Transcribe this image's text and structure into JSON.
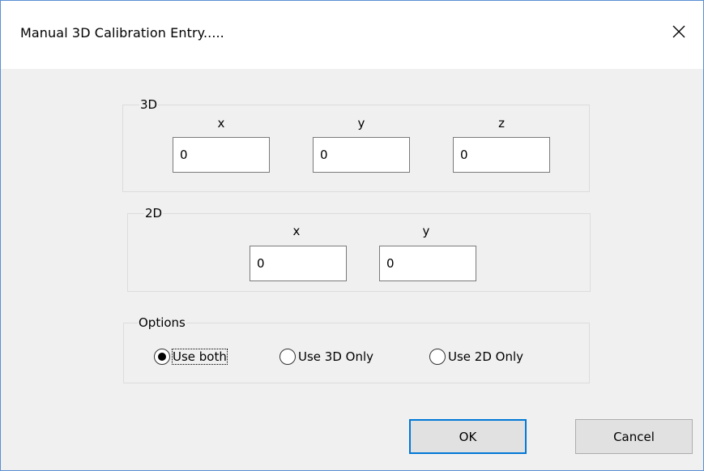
{
  "window": {
    "title": "Manual 3D Calibration Entry.....",
    "close_icon": "close-icon"
  },
  "group_3d": {
    "legend": "3D",
    "x_label": "x",
    "y_label": "y",
    "z_label": "z",
    "x_value": "0",
    "y_value": "0",
    "z_value": "0"
  },
  "group_2d": {
    "legend": "2D",
    "x_label": "x",
    "y_label": "y",
    "x_value": "0",
    "y_value": "0"
  },
  "options": {
    "legend": "Options",
    "items": [
      {
        "label": "Use both",
        "checked": true
      },
      {
        "label": "Use 3D Only",
        "checked": false
      },
      {
        "label": "Use 2D Only",
        "checked": false
      }
    ]
  },
  "buttons": {
    "ok": "OK",
    "cancel": "Cancel"
  },
  "colors": {
    "window_border": "#5b8fd3",
    "default_button_border": "#0078d7",
    "dialog_background": "#f0f0f0"
  }
}
